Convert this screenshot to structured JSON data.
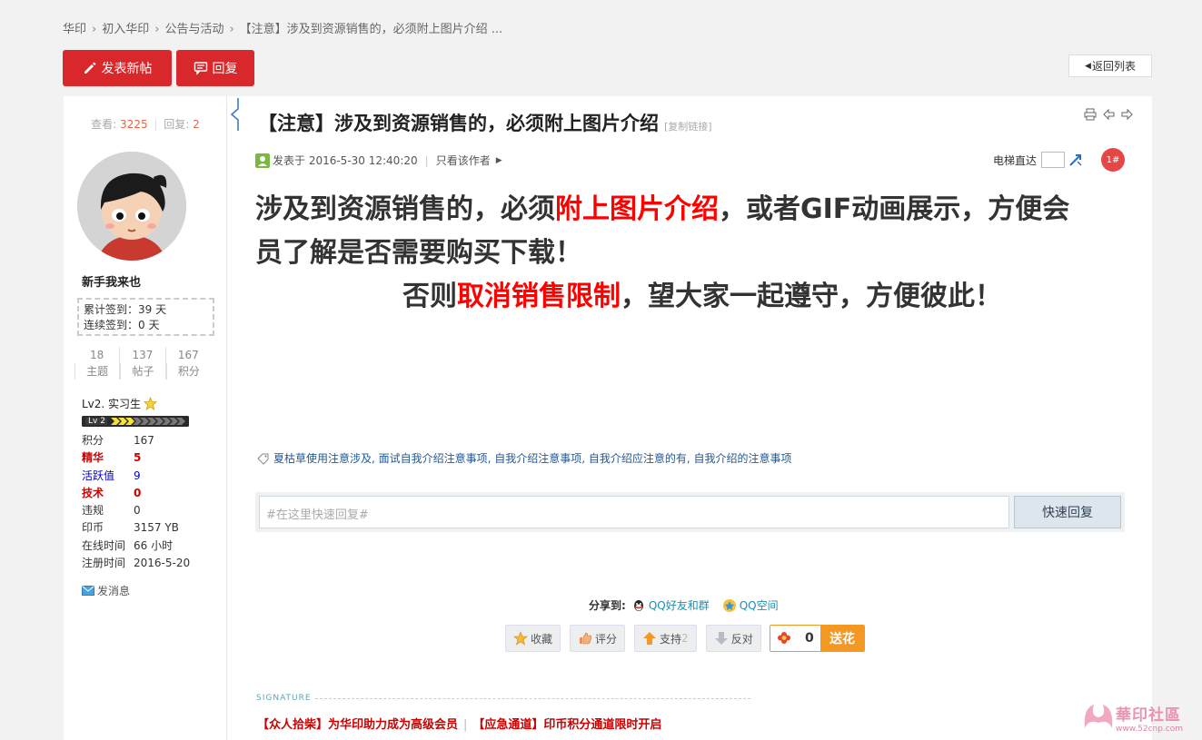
{
  "breadcrumb": [
    "华印",
    "初入华印",
    "公告与活动",
    "【注意】涉及到资源销售的，必须附上图片介绍 ..."
  ],
  "toolbar": {
    "new_post": "发表新帖",
    "reply": "回复",
    "back_list": "返回列表"
  },
  "sidebar": {
    "views_label": "查看:",
    "views": "3225",
    "replies_label": "回复:",
    "replies": "2",
    "username": "新手我来也",
    "sign_total": "累计签到：39 天",
    "sign_streak": "连续签到：0 天",
    "stats": [
      {
        "value": "18",
        "label": "主题"
      },
      {
        "value": "137",
        "label": "帖子"
      },
      {
        "value": "167",
        "label": "积分"
      }
    ],
    "level": "Lv2. 实习生",
    "level_badge": "Lv 2",
    "profile": [
      {
        "key": "积分",
        "value": "167",
        "color": "#333333",
        "bold": false
      },
      {
        "key": "精华",
        "value": "5",
        "color": "#cc0000",
        "bold": true
      },
      {
        "key": "活跃值",
        "value": "9",
        "color": "#0000cc",
        "bold": false
      },
      {
        "key": "技术",
        "value": "0",
        "color": "#cc0000",
        "bold": true
      },
      {
        "key": "违规",
        "value": "0",
        "color": "#333333",
        "bold": false
      },
      {
        "key": "印币",
        "value": "3157 YB",
        "color": "#333333",
        "bold": false
      },
      {
        "key": "在线时间",
        "value": "66 小时",
        "color": "#333333",
        "bold": false
      },
      {
        "key": "注册时间",
        "value": "2016-5-20",
        "color": "#333333",
        "bold": false
      }
    ],
    "send_message": "发消息"
  },
  "post": {
    "title": "【注意】涉及到资源销售的，必须附上图片介绍",
    "copy_link": "[复制链接]",
    "posted_at": "发表于 2016-5-30 12:40:20",
    "only_author": "只看该作者",
    "elevator_label": "电梯直达",
    "floor": "1#",
    "content": {
      "l1a": "涉及到资源销售的，必须",
      "l1b": "附上图片介绍",
      "l1c": "，或者GIF动画展示，方便会",
      "l2": "员了解是否需要购买下载！",
      "l3a": "否则",
      "l3b": "取消销售限制",
      "l3c": "，望大家一起遵守，方便彼此！"
    },
    "tags": "夏枯草使用注意涉及, 面试自我介绍注意事项, 自我介绍注意事项, 自我介绍应注意的有, 自我介绍的注意事项"
  },
  "quick_reply": {
    "placeholder": "#在这里快速回复#",
    "button": "快速回复"
  },
  "share": {
    "label": "分享到:",
    "qq_friends": "QQ好友和群",
    "qq_zone": "QQ空间"
  },
  "actions": {
    "favorite": "收藏",
    "rate": "评分",
    "support": "支持",
    "support_count": "2",
    "oppose": "反对",
    "flower_count": "0",
    "flower": "送花"
  },
  "signature": {
    "label": "SIGNATURE",
    "link1": "【众人拾柴】为华印助力成为高级会员",
    "link2": "【应急通道】印币积分通道限时开启"
  },
  "watermark": {
    "text": "華印社區",
    "url": "www.52cnp.com"
  },
  "colors": {
    "brand_red": "#d9282c",
    "accent_orange": "#f39822"
  }
}
